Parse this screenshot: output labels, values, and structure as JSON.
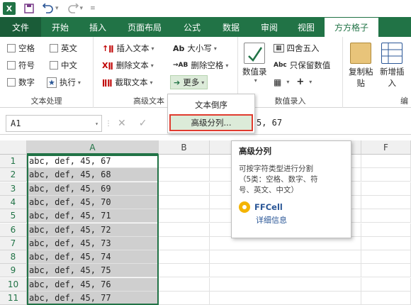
{
  "titlebar": {
    "logo": "X",
    "quick_access": [
      "save-icon",
      "undo-icon",
      "redo-icon"
    ]
  },
  "tabs": [
    "文件",
    "开始",
    "插入",
    "页面布局",
    "公式",
    "数据",
    "审阅",
    "视图",
    "方方格子"
  ],
  "active_tab": "方方格子",
  "ribbon": {
    "text_group": {
      "label": "文本处理",
      "checkboxes": [
        "空格",
        "英文",
        "符号",
        "中文",
        "数字"
      ],
      "run_label": "执行"
    },
    "advanced_group": {
      "label": "高级文本",
      "buttons": [
        "插入文本",
        "删除文本",
        "截取文本",
        "大小写",
        "删除空格",
        "更多"
      ]
    },
    "numeric_group": {
      "label": "数值录入",
      "big_button": "数值录",
      "buttons": [
        "四舍五入",
        "只保留数值"
      ]
    },
    "copy_group": {
      "buttons": [
        "复制粘",
        "贴",
        "新增插",
        "入"
      ],
      "label_partial": "编"
    }
  },
  "more_menu": {
    "items": [
      "文本倒序",
      "高级分列..."
    ],
    "highlighted_index": 1
  },
  "formula_bar": {
    "name_box": "A1",
    "formula_visible": "5, 67"
  },
  "grid": {
    "columns": [
      "A",
      "B",
      "",
      "F"
    ],
    "rows": [
      {
        "num": "1",
        "value": "abc, def, 45, 67"
      },
      {
        "num": "2",
        "value": "abc, def, 45, 68"
      },
      {
        "num": "3",
        "value": "abc, def, 45, 69"
      },
      {
        "num": "4",
        "value": "abc, def, 45, 70"
      },
      {
        "num": "5",
        "value": "abc, def, 45, 71"
      },
      {
        "num": "6",
        "value": "abc, def, 45, 72"
      },
      {
        "num": "7",
        "value": "abc, def, 45, 73"
      },
      {
        "num": "8",
        "value": "abc, def, 45, 74"
      },
      {
        "num": "9",
        "value": "abc, def, 45, 75"
      },
      {
        "num": "10",
        "value": "abc, def, 45, 76"
      },
      {
        "num": "11",
        "value": "abc, def, 45, 77"
      }
    ]
  },
  "tooltip": {
    "title": "高级分列",
    "desc_line1": "可按字符类型进行分割",
    "desc_line2": "（5类：空格、数字、符",
    "desc_line3": "号、英文、中文）",
    "brand": "FFCell",
    "link": "详细信息"
  },
  "colors": {
    "excel_green": "#217346",
    "highlight_red": "#e03b2f",
    "link_blue": "#2b5797"
  }
}
